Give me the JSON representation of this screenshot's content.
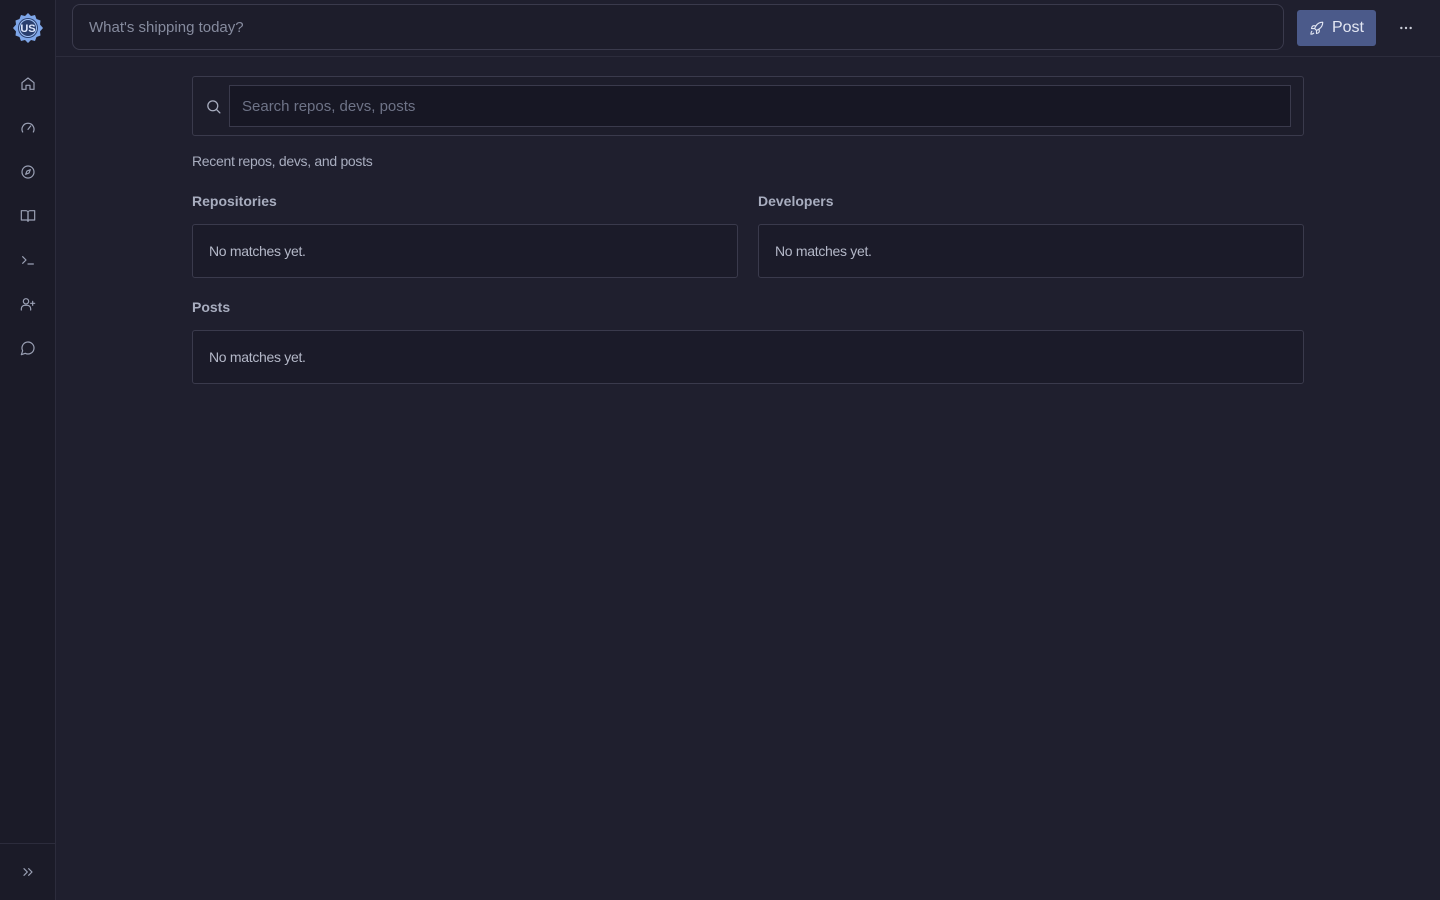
{
  "app": {
    "logo_text": "US",
    "accent": "#4b5a8a"
  },
  "sidebar": {
    "items": [
      {
        "name": "home",
        "icon": "home-icon"
      },
      {
        "name": "dashboard",
        "icon": "gauge-icon"
      },
      {
        "name": "explore",
        "icon": "compass-icon"
      },
      {
        "name": "docs",
        "icon": "book-icon"
      },
      {
        "name": "terminal",
        "icon": "terminal-icon"
      },
      {
        "name": "add-user",
        "icon": "user-plus-icon"
      },
      {
        "name": "messages",
        "icon": "chat-icon"
      }
    ],
    "collapse_icon": "chevrons-right-icon"
  },
  "topbar": {
    "compose_placeholder": "What's shipping today?",
    "post_label": "Post",
    "post_icon": "rocket-icon",
    "more_icon": "ellipsis-icon"
  },
  "search": {
    "placeholder": "Search repos, devs, posts",
    "recent_label": "Recent repos, devs, and posts"
  },
  "sections": {
    "repositories": {
      "title": "Repositories",
      "empty_text": "No matches yet."
    },
    "developers": {
      "title": "Developers",
      "empty_text": "No matches yet."
    },
    "posts": {
      "title": "Posts",
      "empty_text": "No matches yet."
    }
  }
}
